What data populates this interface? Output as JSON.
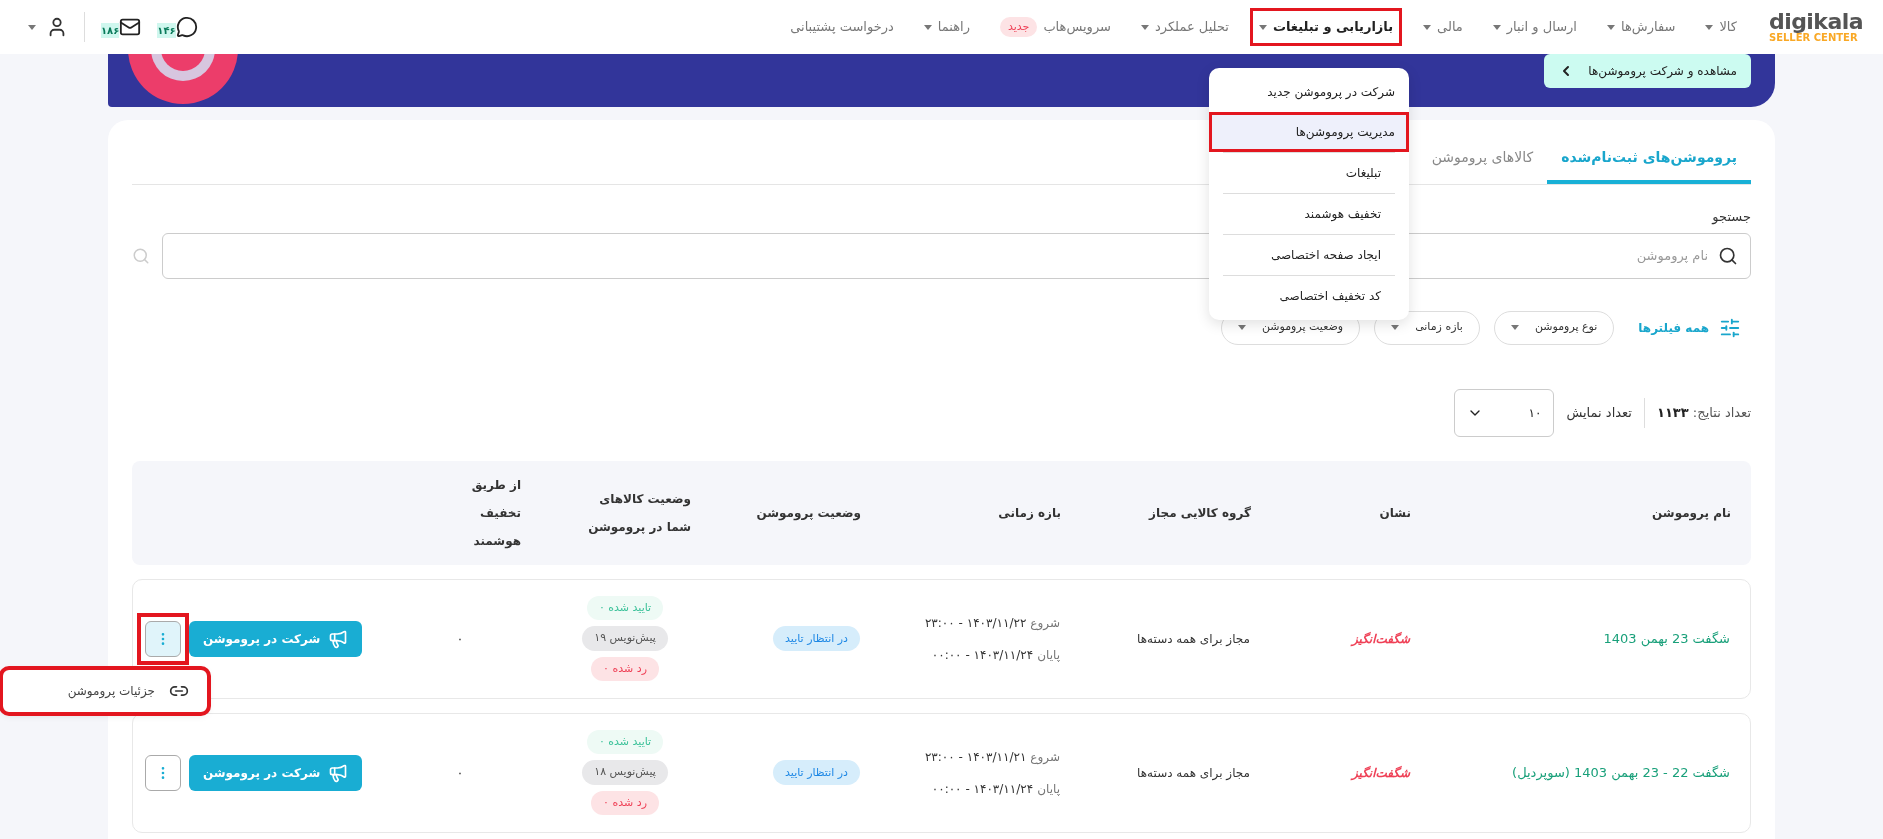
{
  "logo": {
    "name": "digikala",
    "subtitle": "SELLER CENTER"
  },
  "nav": [
    {
      "label": "کالا",
      "has_menu": true,
      "open": false,
      "annotated": false
    },
    {
      "label": "سفارش‌ها",
      "has_menu": true,
      "open": false,
      "annotated": false
    },
    {
      "label": "ارسال و انبار",
      "has_menu": true,
      "open": false,
      "annotated": false
    },
    {
      "label": "مالی",
      "has_menu": true,
      "open": false,
      "annotated": false
    },
    {
      "label": "بازاریابی و تبلیغات",
      "has_menu": true,
      "open": true,
      "annotated": true
    },
    {
      "label": "تحلیل عملکرد",
      "has_menu": true,
      "open": false,
      "annotated": false
    },
    {
      "label": "سرویس‌هاب",
      "has_menu": false,
      "open": false,
      "annotated": false,
      "badge": "جدید"
    },
    {
      "label": "راهنما",
      "has_menu": true,
      "open": false,
      "annotated": false
    },
    {
      "label": "درخواست پشتیبانی",
      "has_menu": false,
      "open": false,
      "annotated": false
    }
  ],
  "nav_menu": [
    {
      "label": "شرکت در پروموشن جدید",
      "selected": false,
      "annotated": false
    },
    {
      "label": "مدیریت پروموشن‌ها",
      "selected": true,
      "annotated": true
    },
    {
      "label": "تبلیغات",
      "selected": false,
      "annotated": false
    },
    {
      "label": "تخفیف هوشمند",
      "selected": false,
      "annotated": false
    },
    {
      "label": "ایجاد صفحه اختصاصی",
      "selected": false,
      "annotated": false
    },
    {
      "label": "کد تخفیف اختصاصی",
      "selected": false,
      "annotated": false
    }
  ],
  "header_tools": {
    "messages_count": "۱۴۶",
    "mail_count": "۱۸۶"
  },
  "banner": {
    "button": "مشاهده و شرکت پروموشن‌ها"
  },
  "tabs": [
    {
      "label": "پروموشن‌های ثبت‌نام‌شده",
      "selected": true
    },
    {
      "label": "کالاهای پروموشن",
      "selected": false
    }
  ],
  "search": {
    "label": "جستجو",
    "placeholder": "نام پروموشن"
  },
  "filters": {
    "all": "همه فیلترها",
    "dropdowns": [
      "نوع پروموشن",
      "بازه زمانی",
      "وضعیت پروموشن"
    ]
  },
  "results": {
    "label": "تعداد نتایج:",
    "count": "۱۱۳۳",
    "page_size_label": "تعداد نمایش",
    "page_size": "۱۰"
  },
  "table": {
    "columns": [
      "نام پروموشن",
      "نشان",
      "گروه کالایی مجاز",
      "بازه زمانی",
      "وضعیت پروموشن",
      "وضعیت کالاهای شما در پروموشن",
      "از طریق تخفیف هوشمند"
    ],
    "rows": [
      {
        "name": "شگفت 23 بهمن 1403",
        "badge": "شگفت‌انگیز",
        "group": "مجاز برای همه دسته‌ها",
        "start_label": "شروع",
        "start": "۱۴۰۳/۱۱/۲۲ - ۲۳:۰۰",
        "end_label": "پایان",
        "end": "۱۴۰۳/۱۱/۲۴ - ۰۰:۰۰",
        "status": "در انتظار تایید",
        "items": [
          {
            "kind": "approved",
            "label": "تایید شده ۰"
          },
          {
            "kind": "draft",
            "label": "پیش‌نویس ۱۹"
          },
          {
            "kind": "rejected",
            "label": "رد شده ۰"
          }
        ],
        "smart": "۰",
        "action": "شرکت در پروموشن",
        "menu_open": true,
        "annotated": true,
        "menu": [
          {
            "label": "جزئیات پروموشن"
          }
        ]
      },
      {
        "name": "شگفت 22 - 23 بهمن 1403 (سوپردیل)",
        "badge": "شگفت‌انگیز",
        "group": "مجاز برای همه دسته‌ها",
        "start_label": "شروع",
        "start": "۱۴۰۳/۱۱/۲۱ - ۲۳:۰۰",
        "end_label": "پایان",
        "end": "۱۴۰۳/۱۱/۲۴ - ۰۰:۰۰",
        "status": "در انتظار تایید",
        "items": [
          {
            "kind": "approved",
            "label": "تایید شده ۰"
          },
          {
            "kind": "draft",
            "label": "پیش‌نویس ۱۸"
          },
          {
            "kind": "rejected",
            "label": "رد شده ۰"
          }
        ],
        "smart": "۰",
        "action": "شرکت در پروموشن",
        "menu_open": false,
        "annotated": false,
        "menu": []
      }
    ]
  }
}
